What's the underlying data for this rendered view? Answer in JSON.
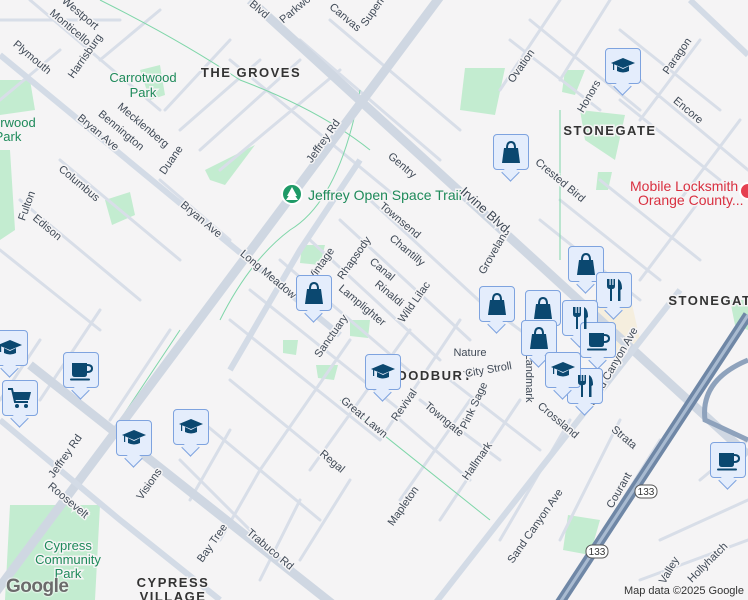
{
  "neighborhoods": [
    "THE GROVES",
    "STONEGATE",
    "STONEGATE",
    "WOODBURY",
    "CYPRESS",
    "VILLAGE"
  ],
  "parks": [
    "Carrotwood",
    "Park",
    "rwood",
    "Park",
    "Cypress",
    "Community",
    "Park",
    "Jeffrey Open Space Trail"
  ],
  "business": {
    "line1": "Mobile Locksmith",
    "line2": "Orange County..."
  },
  "streets": [
    "Westport",
    "Monticello",
    "Plymouth",
    "Harrisburg",
    "Mecklenberg",
    "Bennington",
    "Duane",
    "Columbus",
    "Fulton",
    "Edison",
    "Bryan Ave",
    "Bryan Ave",
    "Jeffrey Rd",
    "Jeffrey Rd",
    "Blvd",
    "Parkwood",
    "Canvas",
    "Superior",
    "Gentry",
    "Townsend",
    "Chantilly",
    "Canal",
    "Rinaldi",
    "Wild Lilac",
    "Lamplighter",
    "Rhapsody",
    "Vintage",
    "Long Meadow",
    "Sanctuary",
    "Great Lawn",
    "Regal",
    "Revival",
    "Towngate",
    "Pink Sage",
    "City Stroll",
    "Nature",
    "Landmark",
    "Hallmark",
    "Mapleton",
    "Crossland",
    "Strata",
    "Courant",
    "Sand Canyon Ave",
    "Sand Canyon Ave",
    "Groveland",
    "Crested Bird",
    "Ovation",
    "Honors",
    "Paragon",
    "Encore",
    "Visions",
    "Roosevelt",
    "Bay Tree",
    "Trabuco Rd",
    "Irvine Blvd",
    "Valley",
    "Hollyhatch"
  ],
  "route_shields": [
    "133",
    "133"
  ],
  "markers": [
    "school",
    "shopping-bag",
    "shopping-bag",
    "restaurant",
    "shopping-bag",
    "shopping-bag",
    "shopping-bag",
    "shopping-bag",
    "restaurant",
    "coffee",
    "school",
    "restaurant",
    "school",
    "coffee",
    "school",
    "shopping-cart",
    "school",
    "school",
    "coffee"
  ],
  "attribution": "Map data ©2025 Google",
  "logo": "Google",
  "colors": {
    "marker_fill": "#e4edfc",
    "marker_border": "#7ea3df",
    "icon": "#0b4870",
    "park": "#c3ecd0",
    "business": "#d93040"
  }
}
